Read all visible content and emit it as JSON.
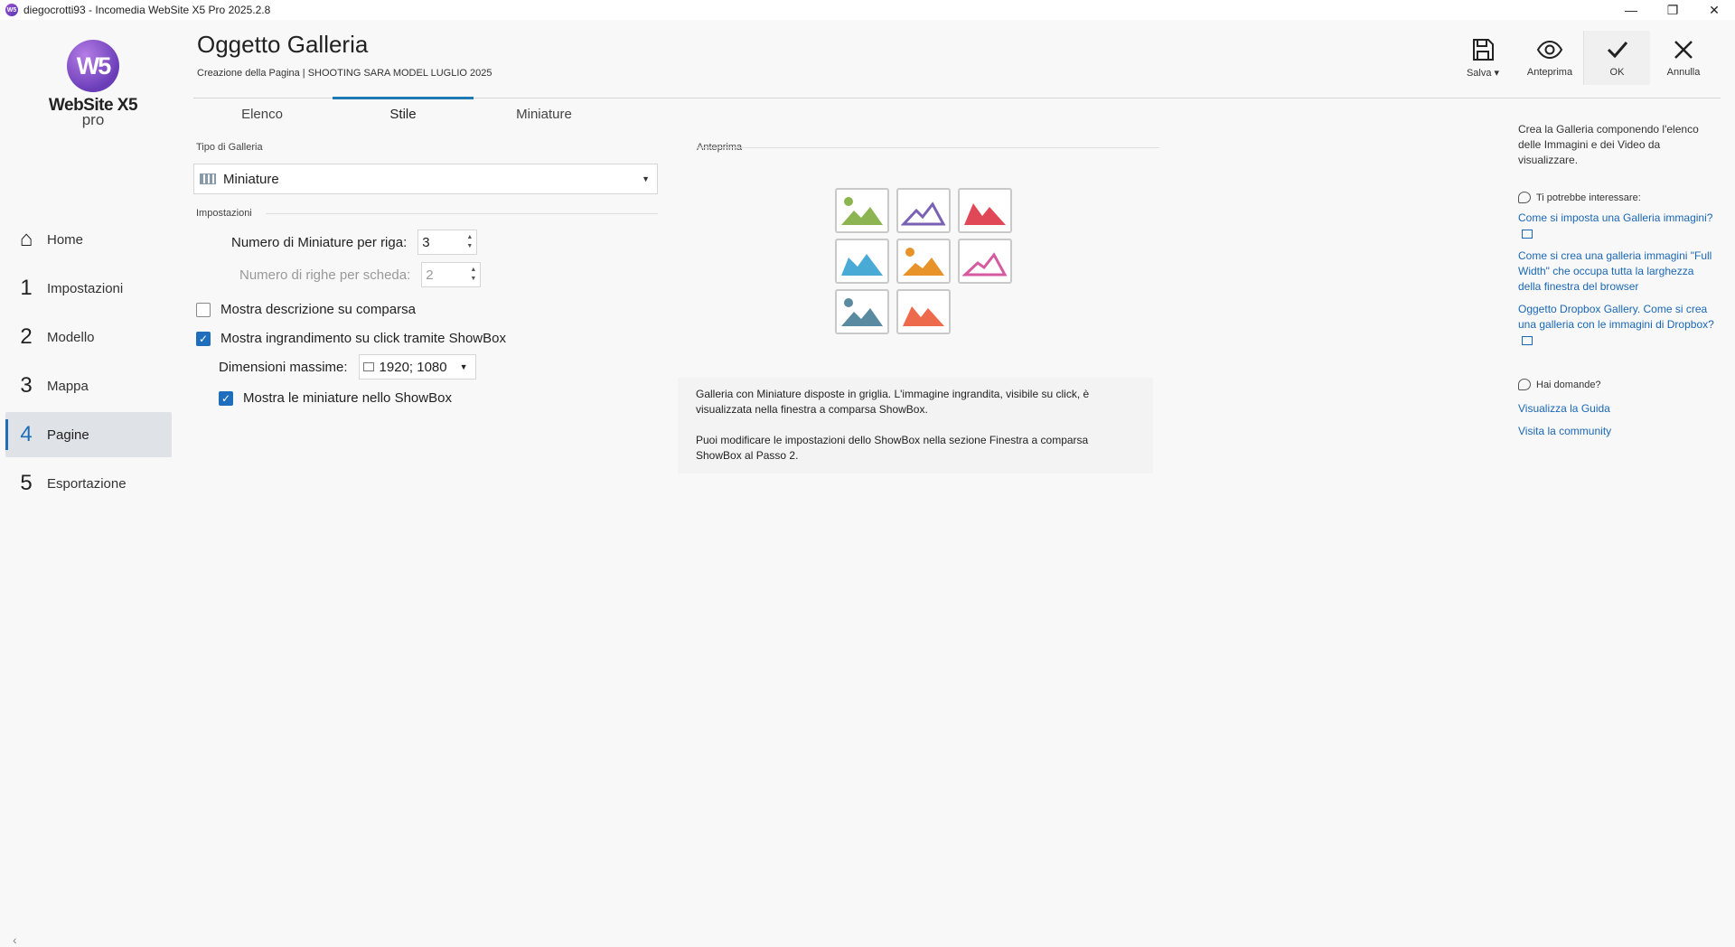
{
  "titlebar": {
    "title": "diegocrotti93 - Incomedia WebSite X5 Pro 2025.2.8",
    "minimize": "—",
    "restore": "❐",
    "close": "✕"
  },
  "logo": {
    "mark": "W5",
    "brand": "WebSite X5",
    "edition": "pro"
  },
  "nav": {
    "items": [
      {
        "num": "⌂",
        "label": "Home"
      },
      {
        "num": "1",
        "label": "Impostazioni"
      },
      {
        "num": "2",
        "label": "Modello"
      },
      {
        "num": "3",
        "label": "Mappa"
      },
      {
        "num": "4",
        "label": "Pagine"
      },
      {
        "num": "5",
        "label": "Esportazione"
      }
    ],
    "active_index": 4,
    "collapse": "‹"
  },
  "header": {
    "title": "Oggetto Galleria",
    "subtitle": "Creazione della Pagina | SHOOTING SARA MODEL LUGLIO 2025"
  },
  "toolbar": {
    "save": "Salva ▾",
    "preview": "Anteprima",
    "ok": "OK",
    "cancel": "Annulla"
  },
  "tabs": [
    {
      "label": "Elenco"
    },
    {
      "label": "Stile"
    },
    {
      "label": "Miniature"
    }
  ],
  "form": {
    "type_section": "Tipo di Galleria",
    "type_value": "Miniature",
    "settings_section": "Impostazioni",
    "per_row_label": "Numero di Miniature per riga:",
    "per_row_value": "3",
    "rows_label": "Numero di righe per scheda:",
    "rows_value": "2",
    "show_desc_label": "Mostra descrizione su comparsa",
    "show_desc_checked": false,
    "showbox_label": "Mostra ingrandimento su click tramite ShowBox",
    "showbox_checked": true,
    "max_dim_label": "Dimensioni massime:",
    "max_dim_value": "1920; 1080",
    "thumbs_showbox_label": "Mostra le miniature nello ShowBox",
    "thumbs_showbox_checked": true
  },
  "preview": {
    "section": "Anteprima",
    "colors": [
      "#8cb552",
      "#7a61b3",
      "#e04858",
      "#4aaad6",
      "#e8922a",
      "#d65aa0",
      "#5a8aa0",
      "#ee6a4c"
    ],
    "desc1": "Galleria con Miniature disposte in griglia. L'immagine ingrandita, visibile su click, è visualizzata nella finestra a comparsa ShowBox.",
    "desc2": "Puoi modificare le impostazioni dello ShowBox nella sezione Finestra a comparsa ShowBox al Passo 2."
  },
  "help": {
    "intro": "Crea la Galleria componendo l'elenco delle Immagini e dei Video da visualizzare.",
    "interest_head": "Ti potrebbe interessare:",
    "links": [
      "Come si imposta una Galleria immagini?",
      "Come si crea una galleria immagini \"Full Width\" che occupa tutta la larghezza della finestra del browser",
      "Oggetto Dropbox Gallery. Come si crea una galleria con le immagini di Dropbox?"
    ],
    "questions_head": "Hai domande?",
    "guide": "Visualizza la Guida",
    "community": "Visita la community"
  }
}
